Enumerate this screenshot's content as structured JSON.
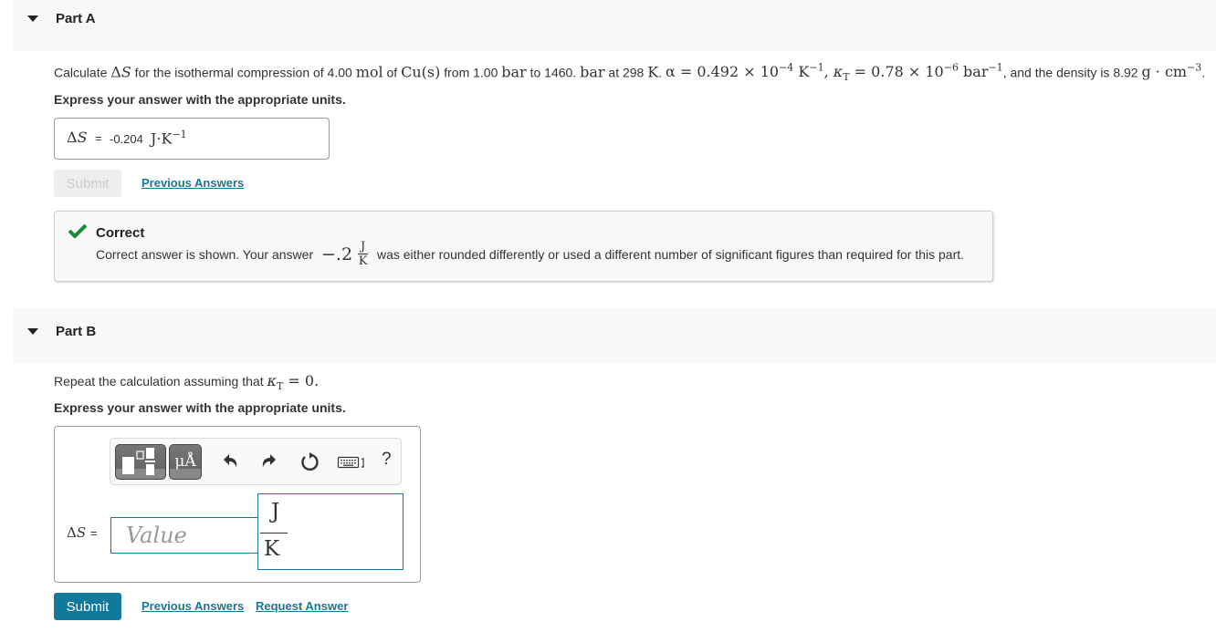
{
  "partA": {
    "title": "Part A",
    "prompt": {
      "t1": "Calculate ",
      "delta_s": "ΔS",
      "t2": " for the isothermal compression of 4.00 ",
      "mol": "mol",
      "t3": " of ",
      "cu": "Cu(s)",
      "t4": " from 1.00 ",
      "bar1": "bar",
      "t5": " to 1460. ",
      "bar2": "bar",
      "t6": " at 298 ",
      "k": "K",
      "t7": ". ",
      "alpha_expr": "α = 0.492 × 10",
      "alpha_exp": "−4",
      "alpha_unit": " K",
      "alpha_unit_exp": "−1",
      "comma": ", ",
      "kappa": "κ",
      "kappa_sub": "T",
      "kappa_expr": " = 0.78 × 10",
      "kappa_exp": "−6",
      "kappa_unit": " bar",
      "kappa_unit_exp": "−1",
      "t8": ", and the density is 8.92 ",
      "density_unit": "g · cm",
      "density_exp": "−3",
      "t9": "."
    },
    "express": "Express your answer with the appropriate units.",
    "answer": {
      "label": "ΔS",
      "equals": "=",
      "value": "-0.204",
      "unit": "J·K",
      "unit_exp": "−1"
    },
    "submit_label": "Submit",
    "previous_answers_label": "Previous Answers",
    "feedback": {
      "title": "Correct",
      "text_before": "Correct answer is shown. Your answer ",
      "your_answer": "−.2",
      "unit_num": "J",
      "unit_den": "K",
      "text_after": " was either rounded differently or used a different number of significant figures than required for this part.",
      "status_color": "#1a8a3a"
    }
  },
  "partB": {
    "title": "Part B",
    "prompt": {
      "t1": "Repeat the calculation assuming that ",
      "kappa": "κ",
      "kappa_sub": "T",
      "expr": " = 0."
    },
    "express": "Express your answer with the appropriate units.",
    "toolbar": {
      "templates_icon": "templates-icon",
      "units_label": "μÅ",
      "undo_icon": "undo-icon",
      "redo_icon": "redo-icon",
      "reset_icon": "reset-icon",
      "keyboard_icon": "keyboard-icon",
      "help_label": "?"
    },
    "answer": {
      "label": "ΔS",
      "equals": "=",
      "value_placeholder": "Value",
      "unit_num": "J",
      "unit_den": "K"
    },
    "submit_label": "Submit",
    "previous_answers_label": "Previous Answers",
    "request_answer_label": "Request Answer"
  },
  "colors": {
    "accent": "#117a9c",
    "header_bg": "#f8f8f8",
    "correct": "#1a8a3a"
  }
}
